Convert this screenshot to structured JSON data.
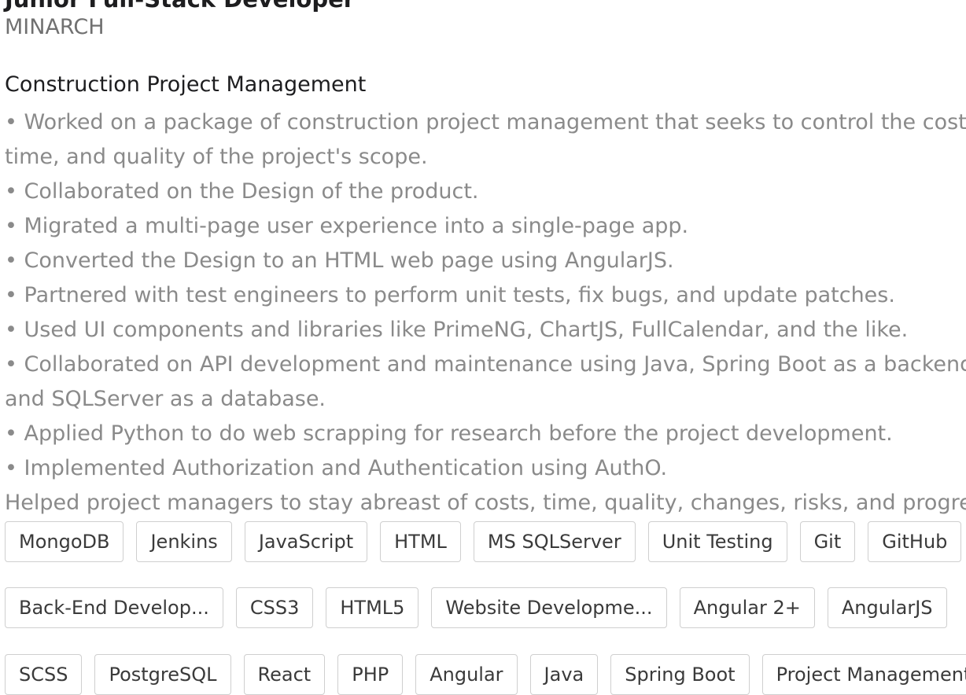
{
  "experience": {
    "job_title": "Junior Full-Stack Developer",
    "company": "MINARCH",
    "project_title": "Construction Project Management",
    "description": [
      "• Worked on a package of construction project management that seeks to control the cost, time, and quality of the project's scope.",
      "• Collaborated on the Design of the product.",
      "• Migrated a multi-page user experience into a single-page app.",
      "• Converted the Design to an HTML web page using AngularJS.",
      "• Partnered with test engineers to perform unit tests, fix bugs, and update patches.",
      "• Used UI components and libraries like PrimeNG, ChartJS, FullCalendar, and the like.",
      "• Collaborated on API development and maintenance using Java, Spring Boot as a backend, and SQLServer as a database.",
      "• Applied Python to do web scrapping for research before the project development.",
      "• Implemented Authorization and Authentication using AuthO.",
      "Helped project managers to stay abreast of costs, time, quality, changes, risks, and progress."
    ]
  },
  "skills": {
    "row1": [
      "MongoDB",
      "Jenkins",
      "JavaScript",
      "HTML",
      "MS SQLServer",
      "Unit Testing",
      "Git",
      "GitHub"
    ],
    "row2": [
      "Back-End Develop...",
      "CSS3",
      "HTML5",
      "Website Developme...",
      "Angular 2+",
      "AngularJS"
    ],
    "row3": [
      "SCSS",
      "PostgreSQL",
      "React",
      "PHP",
      "Angular",
      "Java",
      "Spring Boot",
      "Project Management"
    ]
  }
}
